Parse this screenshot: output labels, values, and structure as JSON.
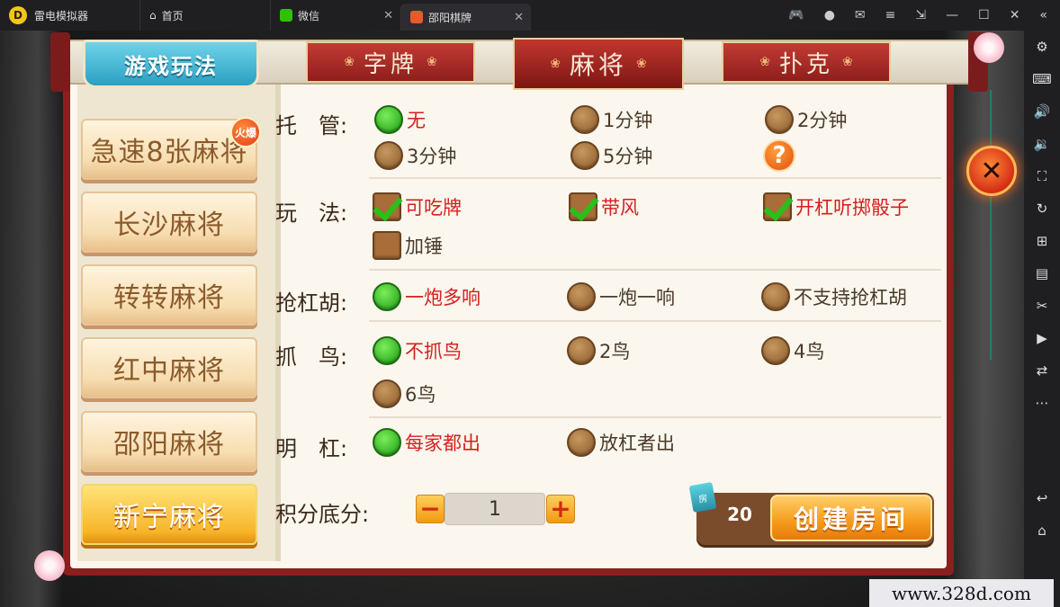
{
  "titlebar": {
    "app_name": "雷电模拟器",
    "tabs": [
      {
        "label": "首页"
      },
      {
        "label": "微信"
      },
      {
        "label": "邵阳棋牌"
      }
    ]
  },
  "header": {
    "rules_tab": "游戏玩法",
    "categories": [
      "字牌",
      "麻将",
      "扑克"
    ],
    "active_category": "麻将"
  },
  "game_list": {
    "items": [
      "急速8张麻将",
      "长沙麻将",
      "转转麻将",
      "红中麻将",
      "邵阳麻将",
      "新宁麻将"
    ],
    "selected": "新宁麻将",
    "hot_badge": "火爆"
  },
  "options": {
    "trustee": {
      "label": "托　管:",
      "choices": [
        "无",
        "1分钟",
        "2分钟",
        "3分钟",
        "5分钟"
      ],
      "selected": "无"
    },
    "play": {
      "label": "玩　法:",
      "choices": [
        "可吃牌",
        "带风",
        "开杠听掷骰子",
        "加锤"
      ],
      "checked": [
        "可吃牌",
        "带风",
        "开杠听掷骰子"
      ]
    },
    "robkong": {
      "label": "抢杠胡:",
      "choices": [
        "一炮多响",
        "一炮一响",
        "不支持抢杠胡"
      ],
      "selected": "一炮多响"
    },
    "bird": {
      "label": "抓　鸟:",
      "choices": [
        "不抓鸟",
        "2鸟",
        "4鸟",
        "6鸟"
      ],
      "selected": "不抓鸟"
    },
    "kong": {
      "label": "明　杠:",
      "choices": [
        "每家都出",
        "放杠者出"
      ],
      "selected": "每家都出"
    }
  },
  "score": {
    "label": "积分底分:",
    "value": "1",
    "minus": "−",
    "plus": "+"
  },
  "create": {
    "cost": "20",
    "cost_icon": "房",
    "button": "创建房间"
  },
  "watermark": "www.328d.com",
  "colors": {
    "accent_red": "#d51f1f",
    "radio_on": "#1a9a13",
    "create_btn": "#f59a1a"
  }
}
